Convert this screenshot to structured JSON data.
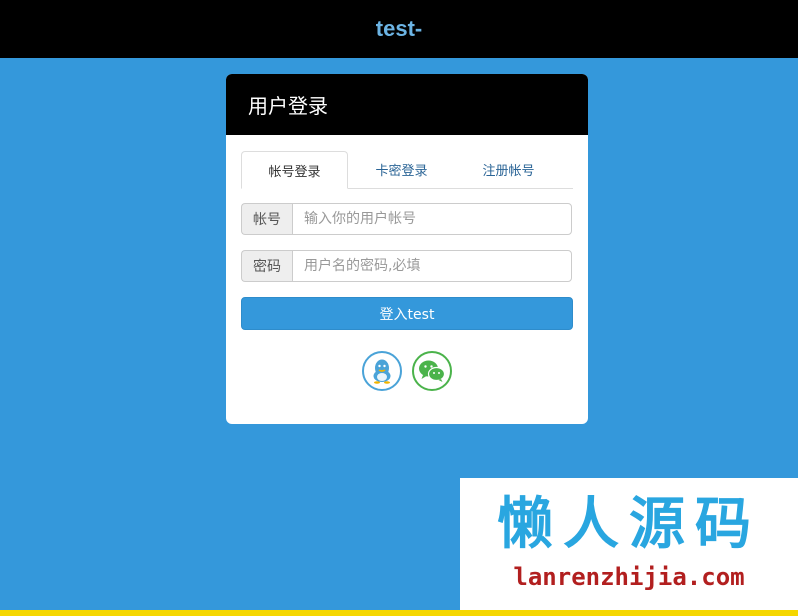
{
  "topbar": {
    "brand": "test-"
  },
  "panel": {
    "title": "用户登录"
  },
  "tabs": [
    {
      "label": "帐号登录",
      "active": true
    },
    {
      "label": "卡密登录",
      "active": false
    },
    {
      "label": "注册帐号",
      "active": false
    }
  ],
  "form": {
    "account": {
      "label": "帐号",
      "placeholder": "输入你的用户帐号",
      "value": ""
    },
    "password": {
      "label": "密码",
      "placeholder": "用户名的密码,必填",
      "value": ""
    },
    "submit_label": "登入test"
  },
  "social": [
    {
      "icon": "qq-penguin-icon",
      "color": "#4aa3d8"
    },
    {
      "icon": "wechat-icon",
      "color": "#4bb34b"
    }
  ],
  "watermark": {
    "title": "懒人源码",
    "url": "lanrenzhijia.com"
  },
  "colors": {
    "background": "#3498db",
    "header": "#000000",
    "button": "#3498db",
    "strip": "#f5d700"
  }
}
